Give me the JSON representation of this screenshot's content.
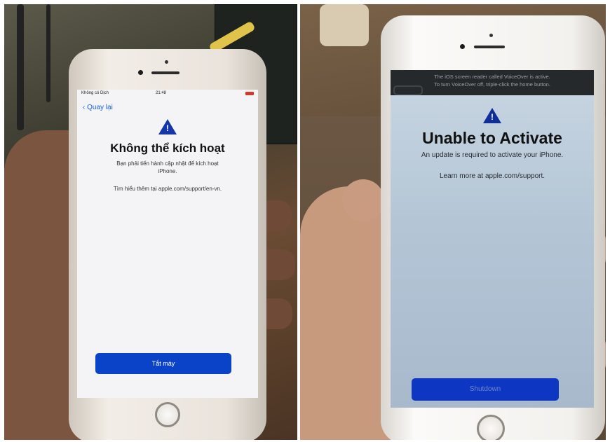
{
  "left_phone": {
    "status_carrier": "Không có Dịch",
    "status_time": "21:48",
    "back_label": "Quay lại",
    "warning_icon": "warning-triangle-icon",
    "title": "Không thể kích hoạt",
    "message": "Bạn phải tiến hành cập nhật để kích hoạt iPhone.",
    "learn_more": "Tìm hiểu thêm tại apple.com/support/en-vn.",
    "button_label": "Tắt máy"
  },
  "right_phone": {
    "voiceover_line1": "The iOS screen reader called VoiceOver is active.",
    "voiceover_line2": "To turn VoiceOver off, triple-click the home button.",
    "warning_icon": "warning-triangle-icon",
    "title": "Unable to Activate",
    "message": "An update is required to activate your iPhone.",
    "learn_more": "Learn more at apple.com/support.",
    "button_label": "Shutdown"
  },
  "colors": {
    "accent_blue": "#0b43c8",
    "link_blue": "#1a5fd9",
    "warning_blue": "#1436a8"
  }
}
